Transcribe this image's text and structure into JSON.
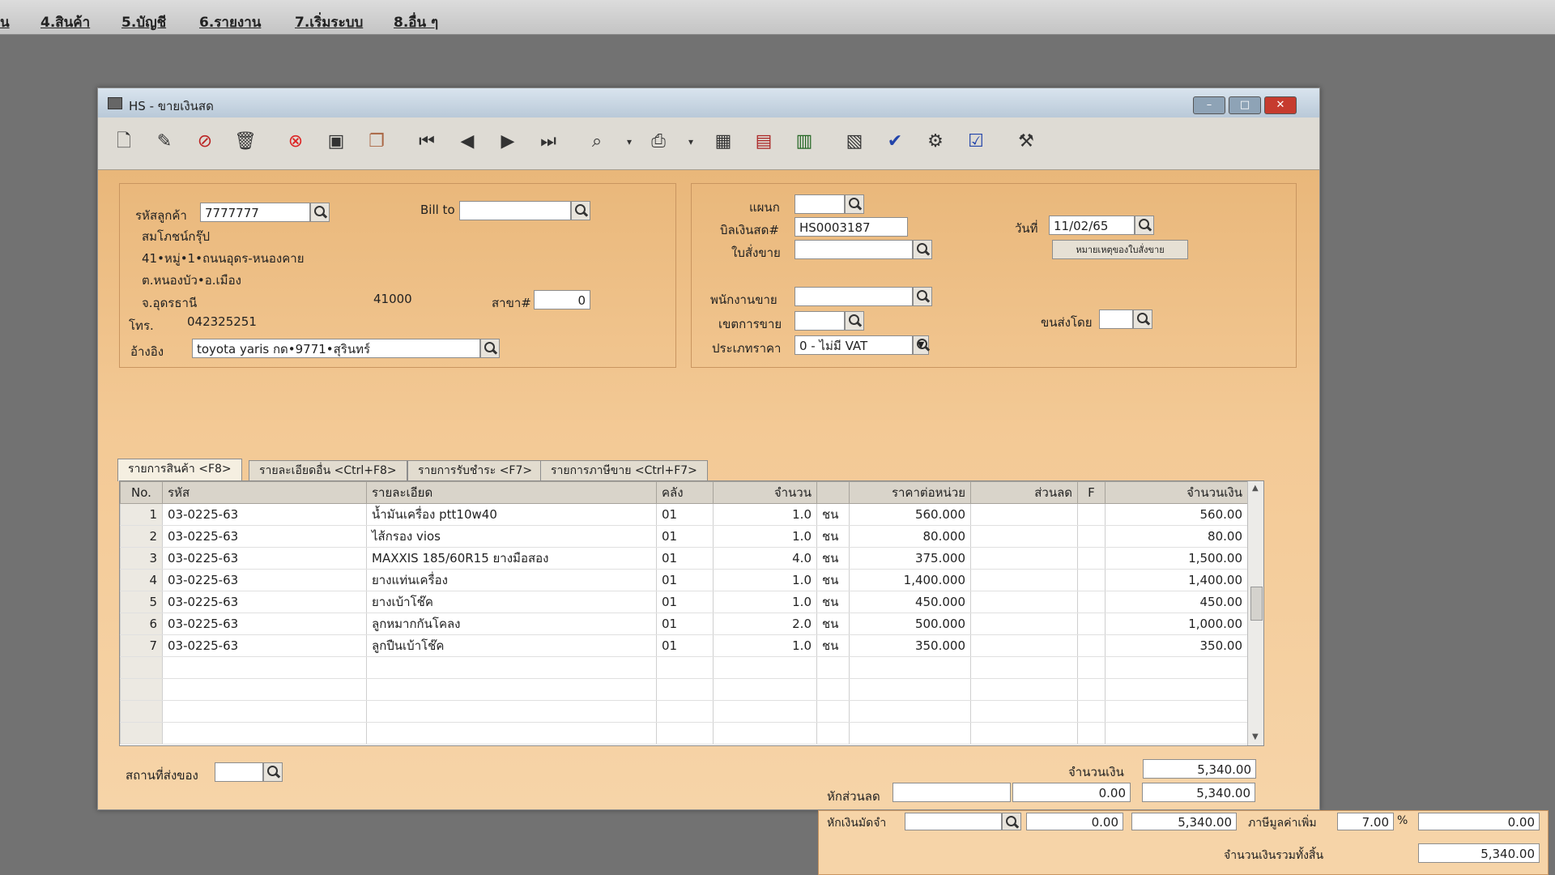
{
  "menu": [
    "น",
    "4.สินค้า",
    "5.บัญชี",
    "6.รายงาน",
    "7.เริ่มระบบ",
    "8.อื่น ๆ"
  ],
  "window": {
    "title": "HS - ขายเงินสด"
  },
  "customer": {
    "code_label": "รหัสลูกค้า",
    "code": "7777777",
    "name": "สมโภชน์กรุ๊ป",
    "addr1": "41•หมู่•1•ถนนอุดร-หนองคาย",
    "addr2": "ต.หนองบัว•อ.เมือง",
    "addr3": "จ.อุดรธานี",
    "postcode": "41000",
    "branch_label": "สาขา#",
    "branch": "0",
    "phone_label": "โทร.",
    "phone": "042325251",
    "ref_label": "อ้างอิง",
    "ref": "toyota yaris กด•9771•สุรินทร์",
    "billto_label": "Bill to",
    "billto": ""
  },
  "doc": {
    "dept_label": "แผนก",
    "dept": "",
    "bill_label": "บิลเงินสด#",
    "bill_no": "HS0003187",
    "date_label": "วันที่",
    "date": "11/02/65",
    "order_label": "ใบสั่งขาย",
    "order": "",
    "order_note_btn": "หมายเหตุของใบสั่งขาย",
    "sales_label": "พนักงานขาย",
    "sales": "",
    "area_label": "เขตการขาย",
    "area": "",
    "ship_label": "ขนส่งโดย",
    "ship": "",
    "price_type_label": "ประเภทราคา",
    "price_type": "0 - ไม่มี VAT"
  },
  "tabs": [
    "รายการสินค้า <F8>",
    "รายละเอียดอื่น <Ctrl+F8>",
    "รายการรับชำระ <F7>",
    "รายการภาษีขาย <Ctrl+F7>"
  ],
  "grid": {
    "headers": [
      "No.",
      "รหัส",
      "รายละเอียด",
      "คลัง",
      "จำนวน",
      "",
      "ราคาต่อหน่วย",
      "ส่วนลด",
      "F",
      "จำนวนเงิน"
    ],
    "rows": [
      [
        "1",
        "03-0225-63",
        "น้ำมันเครื่อง ptt10w40",
        "01",
        "1.0",
        "ชน",
        "560.000",
        "",
        "",
        "560.00"
      ],
      [
        "2",
        "03-0225-63",
        "ไส้กรอง vios",
        "01",
        "1.0",
        "ชน",
        "80.000",
        "",
        "",
        "80.00"
      ],
      [
        "3",
        "03-0225-63",
        "MAXXIS 185/60R15 ยางมือสอง",
        "01",
        "4.0",
        "ชน",
        "375.000",
        "",
        "",
        "1,500.00"
      ],
      [
        "4",
        "03-0225-63",
        "ยางแท่นเครื่อง",
        "01",
        "1.0",
        "ชน",
        "1,400.000",
        "",
        "",
        "1,400.00"
      ],
      [
        "5",
        "03-0225-63",
        "ยางเบ้าโช๊ค",
        "01",
        "1.0",
        "ชน",
        "450.000",
        "",
        "",
        "450.00"
      ],
      [
        "6",
        "03-0225-63",
        "ลูกหมากกันโคลง",
        "01",
        "2.0",
        "ชน",
        "500.000",
        "",
        "",
        "1,000.00"
      ],
      [
        "7",
        "03-0225-63",
        "ลูกปืนเบ้าโช๊ค",
        "01",
        "1.0",
        "ชน",
        "350.000",
        "",
        "",
        "350.00"
      ]
    ]
  },
  "footer": {
    "ship_place_label": "สถานที่ส่งของ",
    "ship_place": "",
    "amount_label": "จำนวนเงิน",
    "amount": "5,340.00",
    "discount_label": "หักส่วนลด",
    "discount_value": "0.00",
    "after_discount": "5,340.00",
    "deposit_label": "หักเงินมัดจำ",
    "deposit_value": "0.00",
    "after_deposit": "5,340.00",
    "vat_label": "ภาษีมูลค่าเพิ่ม",
    "vat_rate": "7.00",
    "vat_unit": "%",
    "vat_amount": "0.00",
    "total_label": "จำนวนเงินรวมทั้งสิ้น",
    "total": "5,340.00"
  }
}
